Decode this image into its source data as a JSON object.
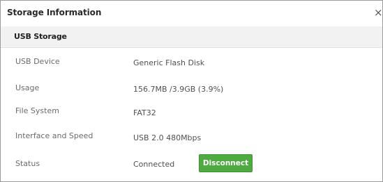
{
  "dialog": {
    "title": "Storage Information",
    "close_glyph": "×",
    "close_icon": "close-icon"
  },
  "section": {
    "title": "USB Storage"
  },
  "rows": [
    {
      "label": "USB Device",
      "value": "Generic Flash Disk"
    },
    {
      "label": "Usage",
      "value": "156.7MB /3.9GB (3.9%)"
    },
    {
      "label": "File System",
      "value": "FAT32"
    },
    {
      "label": "Interface and Speed",
      "value": "USB 2.0 480Mbps"
    },
    {
      "label": "Status",
      "value": "Connected"
    }
  ],
  "actions": {
    "disconnect_label": "Disconnect"
  },
  "colors": {
    "disconnect_button": "#4eaa41",
    "section_band": "#f2f2f2"
  }
}
